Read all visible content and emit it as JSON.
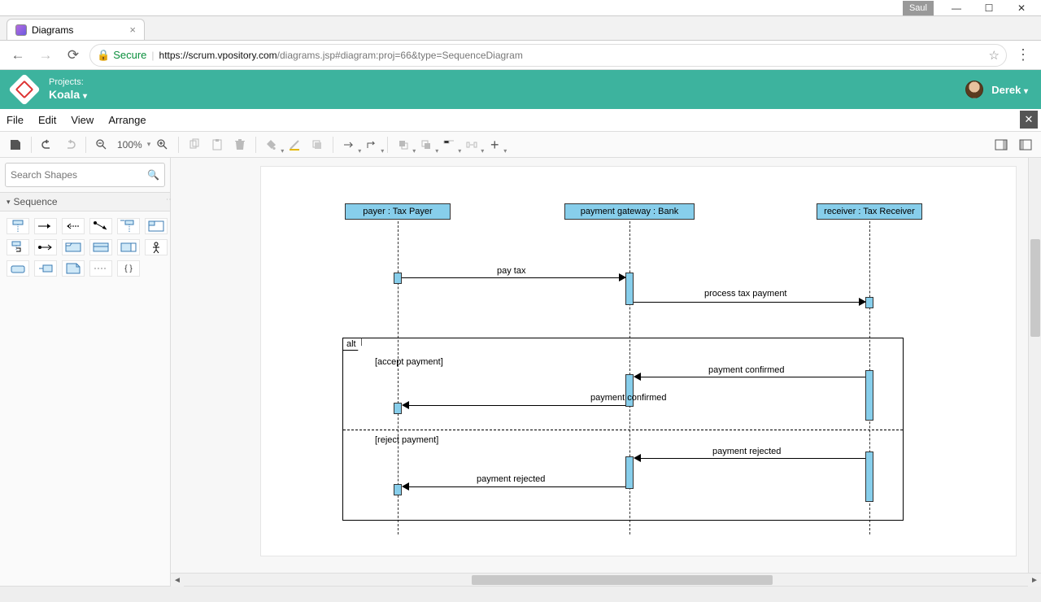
{
  "window": {
    "user_badge": "Saul"
  },
  "browser": {
    "tab_title": "Diagrams",
    "secure_label": "Secure",
    "url_host": "https://scrum.vpository.com",
    "url_path": "/diagrams.jsp#diagram:proj=66&type=SequenceDiagram"
  },
  "header": {
    "projects_label": "Projects:",
    "project_name": "Koala",
    "user_name": "Derek"
  },
  "menus": {
    "file": "File",
    "edit": "Edit",
    "view": "View",
    "arrange": "Arrange"
  },
  "toolbar": {
    "zoom": "100%"
  },
  "palette": {
    "search_placeholder": "Search Shapes",
    "section": "Sequence"
  },
  "diagram": {
    "lifelines": {
      "payer": "payer : Tax Payer",
      "gateway": "payment gateway : Bank",
      "receiver": "receiver : Tax Receiver"
    },
    "messages": {
      "pay_tax": "pay tax",
      "process": "process tax payment",
      "confirmed1": "payment confirmed",
      "confirmed2": "payment confirmed",
      "rejected1": "payment rejected",
      "rejected2": "payment rejected"
    },
    "alt": {
      "tag": "alt",
      "guard_accept": "[accept payment]",
      "guard_reject": "[reject payment]"
    }
  }
}
